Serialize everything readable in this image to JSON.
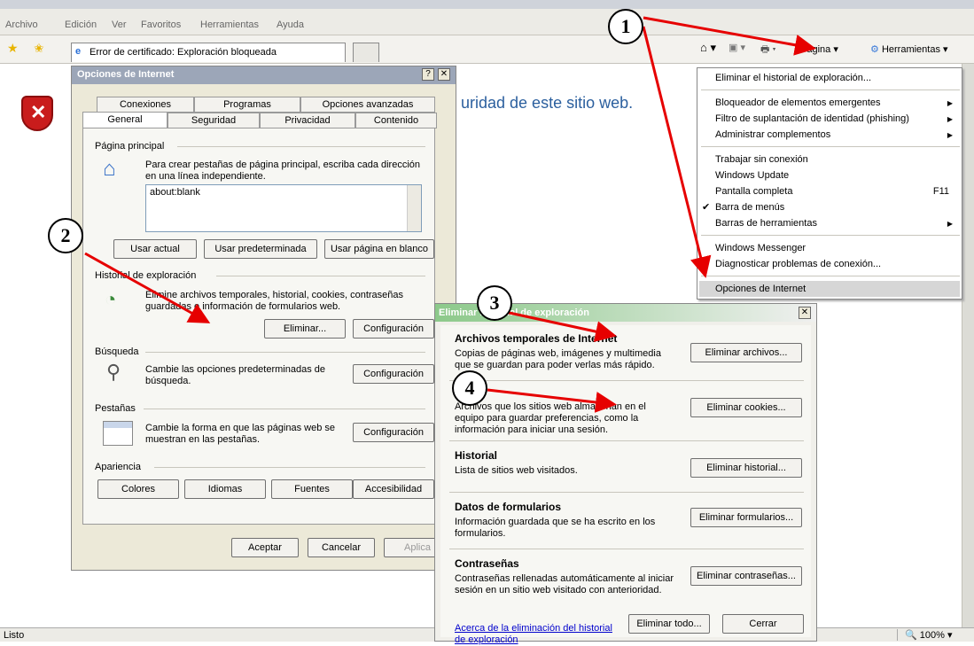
{
  "menubar": {
    "items": [
      "Archivo",
      "Edición",
      "Ver",
      "Favoritos",
      "Herramientas",
      "Ayuda"
    ]
  },
  "browser": {
    "tab_title": "Error de certificado: Exploración bloqueada",
    "toolbar_pagina": "Página",
    "toolbar_herramientas": "Herramientas",
    "page_text": "uridad de este sitio web.",
    "status": "Listo",
    "zoom": "100%"
  },
  "menu": {
    "items": [
      "Eliminar el historial de exploración...",
      "Bloqueador de elementos emergentes",
      "Filtro de suplantación de identidad (phishing)",
      "Administrar complementos",
      "Trabajar sin conexión",
      "Windows Update",
      "Pantalla completa",
      "Barra de menús",
      "Barras de herramientas",
      "Windows Messenger",
      "Diagnosticar problemas de conexión...",
      "Opciones de Internet"
    ],
    "shortcut_f11": "F11"
  },
  "options": {
    "title": "Opciones de Internet",
    "tabs_top": [
      "Conexiones",
      "Programas",
      "Opciones avanzadas"
    ],
    "tabs_bottom": [
      "General",
      "Seguridad",
      "Privacidad",
      "Contenido"
    ],
    "home_label": "Página principal",
    "home_desc": "Para crear pestañas de página principal, escriba cada dirección en una línea independiente.",
    "home_value": "about:blank",
    "btn_actual": "Usar actual",
    "btn_predeterminada": "Usar predeterminada",
    "btn_blanco": "Usar página en blanco",
    "history_label": "Historial de exploración",
    "history_desc": "Elimine archivos temporales, historial, cookies, contraseñas guardadas e información de formularios web.",
    "btn_eliminar": "Eliminar...",
    "btn_config": "Configuración",
    "search_label": "Búsqueda",
    "search_desc": "Cambie las opciones predeterminadas de búsqueda.",
    "tabs_label": "Pestañas",
    "tabs_desc": "Cambie la forma en que las páginas web se muestran en las pestañas.",
    "appearance_label": "Apariencia",
    "btn_colores": "Colores",
    "btn_idiomas": "Idiomas",
    "btn_fuentes": "Fuentes",
    "btn_accesibilidad": "Accesibilidad",
    "btn_aceptar": "Aceptar",
    "btn_cancelar": "Cancelar",
    "btn_aplicar": "Aplica"
  },
  "delete": {
    "title": "Eliminar historial de exploración",
    "temp_title": "Archivos temporales de Internet",
    "temp_desc": "Copias de páginas web, imágenes y multimedia que se guardan para poder verlas más rápido.",
    "btn_temp": "Eliminar archivos...",
    "cookies_desc": "Archivos que los sitios web almacenan en el equipo para guardar preferencias, como la información para iniciar una sesión.",
    "btn_cookies": "Eliminar cookies...",
    "hist_title": "Historial",
    "hist_desc": "Lista de sitios web visitados.",
    "btn_hist": "Eliminar historial...",
    "forms_title": "Datos de formularios",
    "forms_desc": "Información guardada que se ha escrito en los formularios.",
    "btn_forms": "Eliminar formularios...",
    "pw_title": "Contraseñas",
    "pw_desc": "Contraseñas rellenadas automáticamente al iniciar sesión en un sitio web visitado con anterioridad.",
    "btn_pw": "Eliminar contraseñas...",
    "link": "Acerca de la eliminación del historial de exploración",
    "btn_all": "Eliminar todo...",
    "btn_close": "Cerrar"
  },
  "callouts": [
    "1",
    "2",
    "3",
    "4"
  ],
  "colors": {
    "arrow": "#e60000",
    "highlight": "#d6d6d6",
    "link": "#0000cc"
  }
}
